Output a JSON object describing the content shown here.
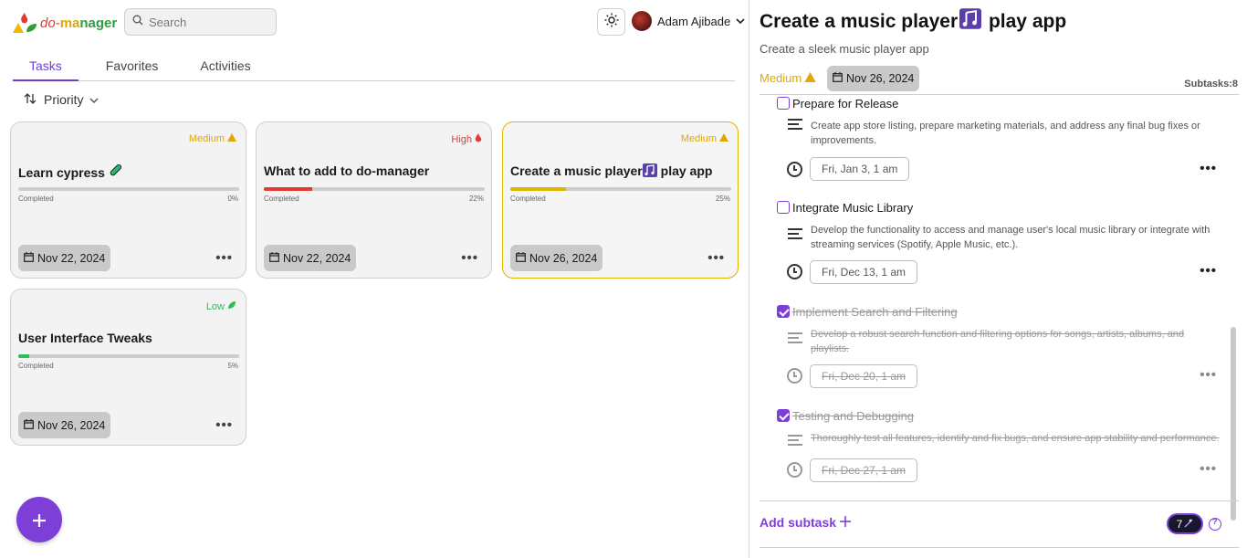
{
  "header": {
    "logo_parts": {
      "do": "do-",
      "ma": "ma",
      "nager": "nager"
    },
    "search_placeholder": "Search",
    "user_name": "Adam Ajibade"
  },
  "tabs": [
    {
      "label": "Tasks",
      "active": true
    },
    {
      "label": "Favorites",
      "active": false
    },
    {
      "label": "Activities",
      "active": false
    }
  ],
  "sort": {
    "label": "Priority"
  },
  "colors": {
    "accent": "#7e3fd9",
    "medium": "#e0a800",
    "high": "#e53935",
    "low": "#2ebd59"
  },
  "cards": [
    {
      "priority": "Medium",
      "priority_color": "#e0a800",
      "priority_icon": "warning-icon",
      "title": "Learn cypress",
      "title_icon": "test-tube-icon",
      "completed_label": "Completed",
      "percent": "0%",
      "progress": 0,
      "bar_color": "#cdcdcd",
      "date": "Nov 22, 2024",
      "selected": false
    },
    {
      "priority": "High",
      "priority_color": "#e53935",
      "priority_icon": "fire-icon",
      "title": "What to add to do-manager",
      "completed_label": "Completed",
      "percent": "22%",
      "progress": 22,
      "bar_color": "#e53935",
      "date": "Nov 22, 2024",
      "selected": false
    },
    {
      "priority": "Medium",
      "priority_color": "#e0a800",
      "priority_icon": "warning-icon",
      "title": "Create a music player",
      "title_suffix": " play app",
      "title_icon": "music-notes-icon",
      "completed_label": "Completed",
      "percent": "25%",
      "progress": 25,
      "bar_color": "#e0b400",
      "date": "Nov 26, 2024",
      "selected": true
    },
    {
      "priority": "Low",
      "priority_color": "#2ebd59",
      "priority_icon": "leaf-icon",
      "title": "User Interface Tweaks",
      "completed_label": "Completed",
      "percent": "5%",
      "progress": 5,
      "bar_color": "#2ebd59",
      "date": "Nov 26, 2024",
      "selected": false
    }
  ],
  "panel": {
    "title_pre": "Create a music player",
    "title_post": " play app",
    "title_icon": "music-notes-icon",
    "subtitle": "Create a sleek music player app",
    "priority": "Medium",
    "date": "Nov 26, 2024",
    "subtasks_label": "Subtasks:8",
    "subtasks": [
      {
        "title": "Prepare for Release",
        "description": "Create app store listing, prepare marketing materials, and address any final bug fixes or improvements.",
        "due": "Fri, Jan 3, 1 am",
        "done": false
      },
      {
        "title": "Integrate Music Library",
        "description": "Develop the functionality to access and manage user's local music library or integrate with streaming services (Spotify, Apple Music, etc.).",
        "due": "Fri, Dec 13, 1 am",
        "done": false
      },
      {
        "title": "Implement Search and Filtering",
        "description": "Develop a robust search function and filtering options for songs, artists, albums, and playlists.",
        "due": "Fri, Dec 20, 1 am",
        "done": true
      },
      {
        "title": "Testing and Debugging",
        "description": "Thoroughly test all features, identify and fix bugs, and ensure app stability and performance.",
        "due": "Fri, Dec 27, 1 am",
        "done": true
      }
    ],
    "add_subtask_label": "Add subtask",
    "comment_count": "7"
  }
}
